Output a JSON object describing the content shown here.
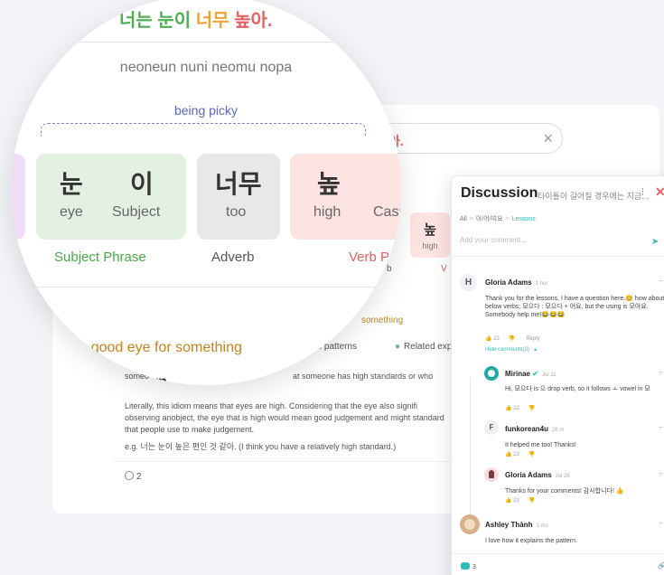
{
  "background": {
    "search_text": "아.",
    "roman_fragment": "opa",
    "chip": {
      "korean": "높",
      "gloss": "high"
    },
    "label_b": "b",
    "label_v": "V",
    "something": "something",
    "tab_patterns": "ed patterns",
    "tab_related": "Related expr",
    "definition_start": "someo",
    "definition_rest": "at someone has high standards or who",
    "literal": "Literally, this idiom means that eyes are high. Considering that the eye also signifi observing anobject, the eye that is high would mean good judgement and might standard that people use to make judgement.",
    "example": "e.g. 너는 눈이 높은 편인 것 같아. (I think you have a relatively high standard.)",
    "comment_count": "2"
  },
  "magnifier": {
    "korean_sentence": {
      "part1": "너는",
      "part2": "눈이",
      "part3": "너무",
      "part4": "높아."
    },
    "romanization": "neoneun nuni neomu nopa",
    "meaning": "being picky",
    "chips": [
      {
        "korean": "눈",
        "gloss": "eye"
      },
      {
        "korean": "이",
        "gloss": "Subject"
      },
      {
        "korean": "너무",
        "gloss": "too"
      },
      {
        "korean": "높",
        "gloss": "high"
      },
      {
        "gloss": "Casu"
      }
    ],
    "labels": {
      "subject": "Subject Phrase",
      "adverb": "Adverb",
      "verb": "Verb P"
    },
    "idiom_meaning": "g a good eye for something",
    "patterns_heading": "r pattern"
  },
  "discussion": {
    "title": "Discussion",
    "subtitle": "타이틀이 길어질 경우에는 지금...",
    "breadcrumb": [
      "All",
      "아/어/여요",
      "Lessons"
    ],
    "placeholder": "Add your comment...",
    "comments": [
      {
        "initial": "H",
        "name": "Gloria Adams",
        "time": "1 hur",
        "text": "Thank you for the lessons, I have a question here.😊 how about below verbs; 모으다 : 모으다 + 어요, but the using is 모아요. Somebody help me!😂😂😂",
        "likes": "22",
        "reply": "Reply",
        "hide": "Hide comments(3)"
      },
      {
        "name": "Mirinae",
        "time": "Jul 11",
        "text": "Hi, 모으다 is 으 drop verb, so it follows ㅗ vowel in 모",
        "likes": "22"
      },
      {
        "initial": "F",
        "name": "funkorean4u",
        "time": "26 m",
        "text": "It helped me too! Thanks!",
        "likes": "22"
      },
      {
        "name": "Gloria Adams",
        "time": "Jul 26",
        "text": "Thanks for your comments! 감사합니다! 👍",
        "likes": "22"
      },
      {
        "name": "Ashley Thành",
        "time": "1 mo",
        "text": "I love how it explains the pattern."
      }
    ],
    "count": "3",
    "colors": {
      "accent": "#2dbdb5",
      "close": "#e2625f"
    }
  }
}
